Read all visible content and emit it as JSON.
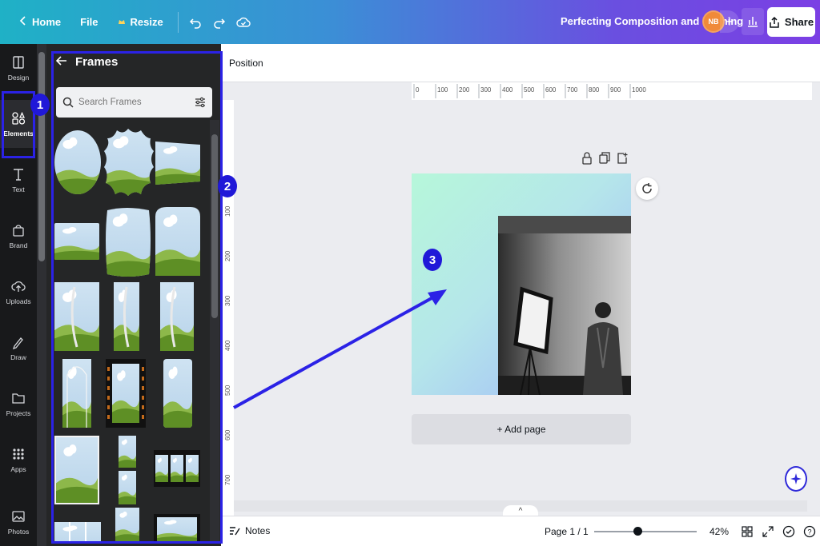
{
  "topbar": {
    "home": "Home",
    "file": "File",
    "resize": "Resize",
    "title": "Perfecting Composition and Framing",
    "avatar_initials": "NB",
    "share": "Share"
  },
  "rail": {
    "items": [
      {
        "label": "Design",
        "icon": "layout-icon"
      },
      {
        "label": "Elements",
        "icon": "shapes-icon"
      },
      {
        "label": "Text",
        "icon": "text-icon"
      },
      {
        "label": "Brand",
        "icon": "brand-icon"
      },
      {
        "label": "Uploads",
        "icon": "cloud-upload-icon"
      },
      {
        "label": "Draw",
        "icon": "pen-icon"
      },
      {
        "label": "Projects",
        "icon": "folder-icon"
      },
      {
        "label": "Apps",
        "icon": "apps-grid-icon"
      },
      {
        "label": "Photos",
        "icon": "image-icon"
      }
    ]
  },
  "panel": {
    "title": "Frames",
    "search_placeholder": "Search Frames"
  },
  "annotations": {
    "badge1": "1",
    "badge2": "2",
    "badge3": "3",
    "color": "#2b22e6"
  },
  "context_bar": {
    "position": "Position"
  },
  "ruler": {
    "top_ticks": [
      "0",
      "100",
      "200",
      "300",
      "400",
      "500",
      "600",
      "700",
      "800",
      "900",
      "1000"
    ],
    "left_ticks": [
      "100",
      "200",
      "300",
      "400",
      "500",
      "600",
      "700"
    ]
  },
  "canvas": {
    "add_page": "+ Add page"
  },
  "bottombar": {
    "notes": "Notes",
    "page_indicator": "Page 1 / 1",
    "zoom": "42%",
    "zoom_fraction": 0.42
  }
}
